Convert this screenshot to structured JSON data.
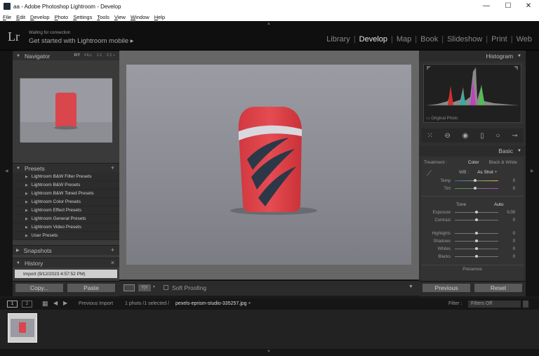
{
  "window": {
    "title": "aa - Adobe Photoshop Lightroom - Develop",
    "minimize": "—",
    "maximize": "☐",
    "close": "✕"
  },
  "menu": [
    {
      "ul": "F",
      "rest": "ile"
    },
    {
      "ul": "E",
      "rest": "dit"
    },
    {
      "ul": "D",
      "rest": "evelop"
    },
    {
      "ul": "P",
      "rest": "hoto"
    },
    {
      "ul": "S",
      "rest": "ettings"
    },
    {
      "ul": "T",
      "rest": "ools"
    },
    {
      "ul": "V",
      "rest": "iew"
    },
    {
      "ul": "W",
      "rest": "indow"
    },
    {
      "ul": "H",
      "rest": "elp"
    }
  ],
  "identity": {
    "logo": "Lr",
    "status": "Waiting for connection",
    "mobile": "Get started with Lightroom mobile  ▸"
  },
  "modules": {
    "library": "Library",
    "develop": "Develop",
    "map": "Map",
    "book": "Book",
    "slideshow": "Slideshow",
    "print": "Print",
    "web": "Web",
    "sep": "|"
  },
  "left": {
    "navigator": {
      "title": "Navigator",
      "fit": "FIT",
      "fill": "FILL",
      "one": "1:1",
      "two": "2:1 ÷"
    },
    "presets": {
      "title": "Presets",
      "items": [
        "Lightroom B&W Filter Presets",
        "Lightroom B&W Presets",
        "Lightroom B&W Toned Presets",
        "Lightroom Color Presets",
        "Lightroom Effect Presets",
        "Lightroom General Presets",
        "Lightroom Video Presets",
        "User Presets"
      ]
    },
    "snapshots": {
      "title": "Snapshots"
    },
    "history": {
      "title": "History",
      "item": "Import (9/12/2023 4:57:52 PM)",
      "close": "×"
    },
    "copy": "Copy...",
    "paste": "Paste"
  },
  "center": {
    "soft_proofing": "Soft Proofing",
    "yy": "Y|Y"
  },
  "right": {
    "histogram": {
      "title": "Histogram",
      "original": "Original Photo"
    },
    "basic": {
      "title": "Basic",
      "treatment": "Treatment :",
      "color": "Color",
      "bw": "Black & White",
      "wb": "WB :",
      "wb_value": "As Shot ÷",
      "temp": "Temp",
      "tint": "Tint",
      "tone": "Tone",
      "auto": "Auto",
      "exposure": "Exposure",
      "contrast": "Contrast",
      "highlights": "Highlights",
      "shadows": "Shadows",
      "whites": "Whites",
      "blacks": "Blacks",
      "presence": "Presence",
      "zero": "0",
      "exposure_val": "0.00"
    },
    "previous": "Previous",
    "reset": "Reset"
  },
  "filmstrip": {
    "view1": "1",
    "view2": "2",
    "source": "Previous Import",
    "count": "1 photo /1 selected /",
    "filename": "pexels-eprism-studio-335257.jpg ÷",
    "filter_label": "Filter :",
    "filter_value": "Filters Off"
  },
  "colors": {
    "accent": "#e8e8e8",
    "panel": "#3a3a3a",
    "product_red": "#e0454a"
  }
}
